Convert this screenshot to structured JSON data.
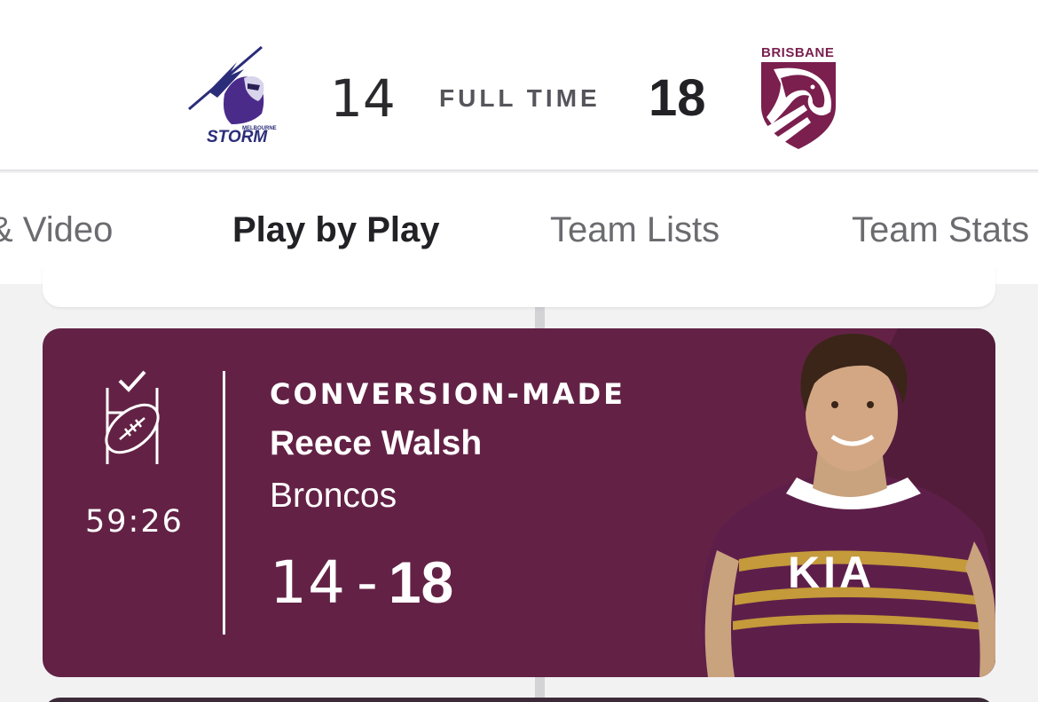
{
  "header": {
    "home_team": "Melbourne Storm",
    "home_logo_text": "STORM",
    "home_logo_subtext": "MELBOURNE",
    "home_score": "14",
    "status": "FULL TIME",
    "away_score": "18",
    "away_team": "Brisbane Broncos",
    "away_logo_text": "BRISBANE"
  },
  "tabs": [
    {
      "label": "& Video",
      "active": false
    },
    {
      "label": "Play by Play",
      "active": true
    },
    {
      "label": "Team Lists",
      "active": false
    },
    {
      "label": "Team Stats",
      "active": false
    }
  ],
  "event": {
    "icon": "conversion-made-icon",
    "time": "59:26",
    "type": "CONVERSION-MADE",
    "player": "Reece Walsh",
    "team": "Broncos",
    "score_home": "14",
    "score_separator": "-",
    "score_away": "18"
  },
  "colors": {
    "card_background": "#632245",
    "tab_indicator": "#6ff0f0",
    "storm_purple": "#5a2a8c",
    "broncos_maroon": "#7a1f4e"
  }
}
